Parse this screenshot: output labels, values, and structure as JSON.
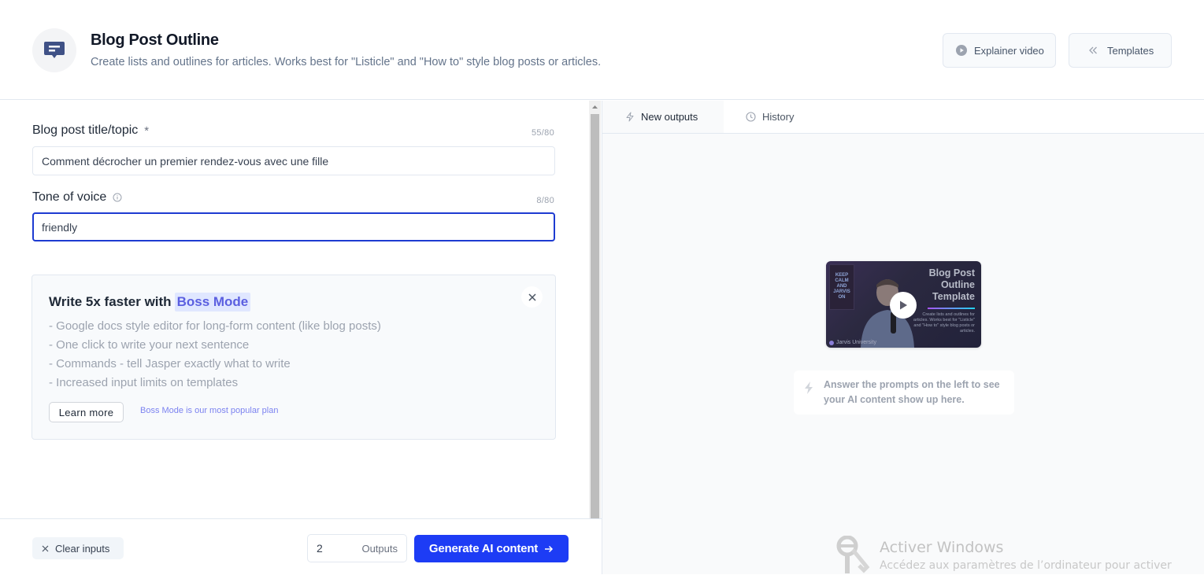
{
  "header": {
    "icon": "chat-message-icon",
    "title": "Blog Post Outline",
    "subtitle": "Create lists and outlines for articles. Works best for \"Listicle\" and \"How to\" style blog posts or articles.",
    "buttons": {
      "explainer": {
        "label": "Explainer video",
        "icon": "play-circle-icon"
      },
      "templates": {
        "label": "Templates",
        "icon": "chevrons-left-icon"
      }
    }
  },
  "form": {
    "fields": [
      {
        "label": "Blog post title/topic",
        "required_marker": "*",
        "counter": "55/80",
        "value": "Comment décrocher un premier rendez-vous avec une fille"
      },
      {
        "label": "Tone of voice",
        "info_icon": "info-icon",
        "counter": "8/80",
        "value": "friendly"
      }
    ]
  },
  "promo": {
    "title_prefix": "Write 5x faster with",
    "title_highlight": "Boss Mode",
    "features": [
      "- Google docs style editor for long-form content (like blog posts)",
      "- One click to write your next sentence",
      "- Commands - tell Jasper exactly what to write",
      "- Increased input limits on templates"
    ],
    "learn_more": "Learn more",
    "note": "Boss Mode is our most popular plan",
    "accent_color": "#5b5fe0",
    "highlight_bg": "#e0e7ff"
  },
  "footer": {
    "clear_label": "Clear inputs",
    "outputs_value": "2",
    "outputs_label": "Outputs",
    "generate_label": "Generate AI content",
    "generate_color": "#1d3cf5"
  },
  "output_panel": {
    "tabs": [
      {
        "label": "New outputs",
        "icon": "lightning-icon",
        "active": true
      },
      {
        "label": "History",
        "icon": "clock-icon",
        "active": false
      }
    ],
    "video": {
      "title_lines": [
        "Blog Post",
        "Outline",
        "Template"
      ],
      "description": "Create lists and outlines for articles. Works best for \"Listicle\" and \"How to\" style blog posts or articles.",
      "brand": "Jarvis University",
      "poster_lines": [
        "KEEP",
        "CALM",
        "AND",
        "JARVIS",
        "ON"
      ]
    },
    "hint": "Answer the prompts on the left to see your AI content show up here."
  },
  "watermark": {
    "title": "Activer Windows",
    "subtitle": "Accédez aux paramètres de l’ordinateur pour activer"
  }
}
